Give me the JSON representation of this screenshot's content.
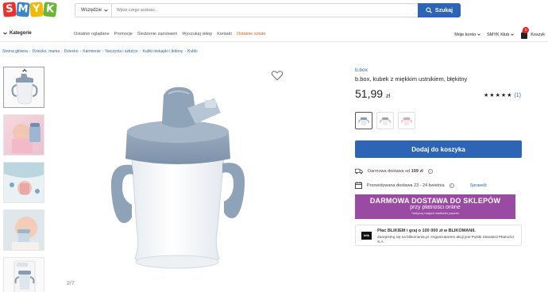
{
  "header": {
    "logo_letters": [
      "S",
      "M",
      "Y",
      "K"
    ],
    "logo_colors": [
      "#e8322d",
      "#3a86c8",
      "#f5b800",
      "#6bb536"
    ],
    "search_category": "Wszędzie",
    "search_placeholder": "Wpisz czego szukasz...",
    "search_button": "Szukaj"
  },
  "nav": {
    "categories_label": "Kategorie",
    "links": [
      "Ostatnio oglądane",
      "Promocje",
      "Śledzenie zamówień",
      "Wyszukaj sklep",
      "Kontakt",
      "Ostatnie sztuki"
    ],
    "account": "Moje konto",
    "club": "SMYK Klub",
    "cart": "Koszyk",
    "cart_count": "0"
  },
  "breadcrumb": [
    "Strona główna",
    "Dziecko, mama",
    "Dziecko",
    "Karmienie",
    "Naczynia i sztućce",
    "Kubki niekapki i bidony",
    "Kubki"
  ],
  "gallery": {
    "page_indicator": "2/7"
  },
  "product": {
    "brand": "b.box",
    "title": "b.box, kubek z miękkim ustnikiem, błękitny",
    "price": "51,99",
    "currency": "zł",
    "rating_count": "(1)",
    "rating": 5,
    "add_to_cart": "Dodaj do koszyka",
    "shipping_prefix": "Darmowa dostawa od",
    "shipping_amount": "199 zł",
    "delivery_prefix": "Przewidywana dostawa",
    "delivery_dates": "23 - 24 kwietnia",
    "check_label": "Sprawdź"
  },
  "promo": {
    "line1": "DARMOWA DOSTAWA DO SKLEPÓW",
    "line2": "przy płatności online",
    "line3": "*dotyczy małych wielkości paczek"
  },
  "blik": {
    "logo": "blik",
    "title": "Płać BLIKIEM i graj o 100 000 zł w BLIKOMANII.",
    "body": "Zarejestruj się na blikomania.pl. Organizatorem akcji jest Polski Standard Płatności S.A."
  },
  "colors": {
    "accent": "#2d64b5",
    "promo": "#9b4aa3",
    "sale": "#e05a1d"
  }
}
